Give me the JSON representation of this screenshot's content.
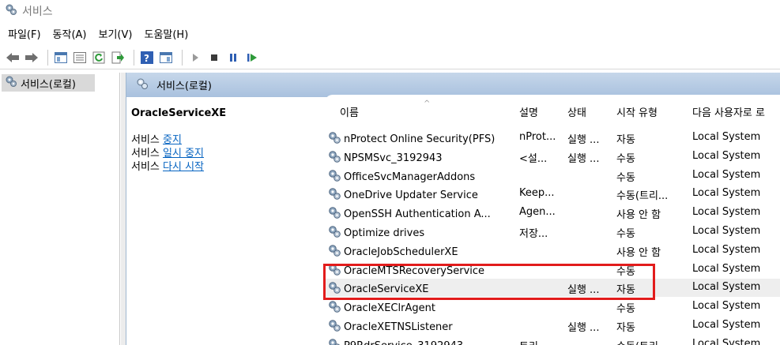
{
  "window": {
    "title": "서비스",
    "icon": "services-gear-icon"
  },
  "menu": [
    "파일(F)",
    "동작(A)",
    "보기(V)",
    "도움말(H)"
  ],
  "toolbar": {
    "buttons": [
      "back-arrow-icon",
      "forward-arrow-icon",
      "show-hide-console-tree-icon",
      "properties-icon",
      "refresh-icon",
      "export-list-icon",
      "help-icon",
      "action-pane-icon",
      "start-service-icon",
      "stop-service-icon",
      "pause-service-icon",
      "resume-service-icon"
    ]
  },
  "tree": {
    "selected_item": "서비스(로컬)"
  },
  "content": {
    "header": "서비스(로컬)",
    "selected_service": "OracleServiceXE",
    "actions": [
      {
        "prefix": "서비스 ",
        "link": "중지"
      },
      {
        "prefix": "서비스 ",
        "link": "일시 중지"
      },
      {
        "prefix": "서비스 ",
        "link": "다시 시작"
      }
    ]
  },
  "columns": {
    "name": "이름",
    "description": "설명",
    "status": "상태",
    "startup": "시작 유형",
    "logon": "다음 사용자로 로"
  },
  "services": [
    {
      "name": "nProtect Online Security(PFS)",
      "description": "nProt...",
      "status": "실행 ...",
      "startup": "자동",
      "logon": "Local System"
    },
    {
      "name": "NPSMSvc_3192943",
      "description": "<설...",
      "status": "실행 ...",
      "startup": "수동",
      "logon": "Local System"
    },
    {
      "name": "OfficeSvcManagerAddons",
      "description": "",
      "status": "",
      "startup": "수동",
      "logon": "Local System"
    },
    {
      "name": "OneDrive Updater Service",
      "description": "Keep...",
      "status": "",
      "startup": "수동(트리...",
      "logon": "Local System"
    },
    {
      "name": "OpenSSH Authentication A...",
      "description": "Agen...",
      "status": "",
      "startup": "사용 안 함",
      "logon": "Local System"
    },
    {
      "name": "Optimize drives",
      "description": "저장...",
      "status": "",
      "startup": "수동",
      "logon": "Local System"
    },
    {
      "name": "OracleJobSchedulerXE",
      "description": "",
      "status": "",
      "startup": "사용 안 함",
      "logon": "Local System"
    },
    {
      "name": "OracleMTSRecoveryService",
      "description": "",
      "status": "",
      "startup": "수동",
      "logon": "Local System"
    },
    {
      "name": "OracleServiceXE",
      "description": "",
      "status": "실행 ...",
      "startup": "자동",
      "logon": "Local System",
      "selected": true
    },
    {
      "name": "OracleXEClrAgent",
      "description": "",
      "status": "",
      "startup": "수동",
      "logon": "Local System"
    },
    {
      "name": "OracleXETNSListener",
      "description": "",
      "status": "실행 ...",
      "startup": "자동",
      "logon": "Local System"
    },
    {
      "name": "P9RdrService_3192943",
      "description": "트리...",
      "status": "",
      "startup": "수동(트리...",
      "logon": "Local System"
    }
  ],
  "colors": {
    "highlight": "#e21c1c",
    "header_gradient_top": "#c6d7ea",
    "header_gradient_bottom": "#a9c1de",
    "link": "#0563c1"
  }
}
